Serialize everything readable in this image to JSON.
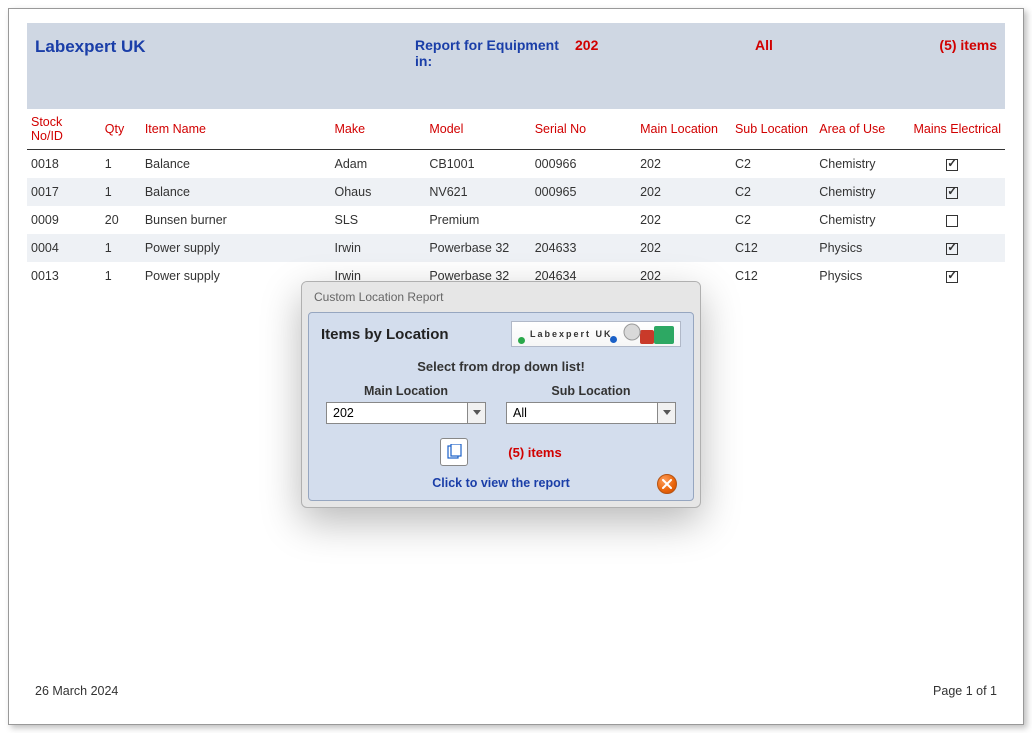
{
  "banner": {
    "title": "Labexpert UK",
    "report_label": "Report for Equipment in:",
    "location_value": "202",
    "filter_value": "All",
    "count_text": "(5) items"
  },
  "columns": {
    "stock": "Stock No/ID",
    "qty": "Qty",
    "item": "Item Name",
    "make": "Make",
    "model": "Model",
    "serial": "Serial No",
    "main_loc": "Main Location",
    "sub_loc": "Sub Location",
    "area": "Area of Use",
    "mains": "Mains Electrical"
  },
  "rows": [
    {
      "stock": "0018",
      "qty": "1",
      "item": "Balance",
      "make": "Adam",
      "model": "CB1001",
      "serial": "000966",
      "main": "202",
      "sub": "C2",
      "area": "Chemistry",
      "mains": true
    },
    {
      "stock": "0017",
      "qty": "1",
      "item": "Balance",
      "make": "Ohaus",
      "model": "NV621",
      "serial": "000965",
      "main": "202",
      "sub": "C2",
      "area": "Chemistry",
      "mains": true
    },
    {
      "stock": "0009",
      "qty": "20",
      "item": "Bunsen burner",
      "make": "SLS",
      "model": "Premium",
      "serial": "",
      "main": "202",
      "sub": "C2",
      "area": "Chemistry",
      "mains": false
    },
    {
      "stock": "0004",
      "qty": "1",
      "item": "Power supply",
      "make": "Irwin",
      "model": "Powerbase 32",
      "serial": "204633",
      "main": "202",
      "sub": "C12",
      "area": "Physics",
      "mains": true
    },
    {
      "stock": "0013",
      "qty": "1",
      "item": "Power supply",
      "make": "Irwin",
      "model": "Powerbase 32",
      "serial": "204634",
      "main": "202",
      "sub": "C12",
      "area": "Physics",
      "mains": true
    }
  ],
  "footer": {
    "date": "26 March 2024",
    "page": "Page 1 of 1"
  },
  "dialog": {
    "title": "Custom Location Report",
    "heading": "Items by Location",
    "logo_text": "Labexpert UK",
    "subtitle": "Select from drop down list!",
    "main_label": "Main Location",
    "main_value": "202",
    "sub_label": "Sub Location",
    "sub_value": "All",
    "count_text": "(5) items",
    "link_text": "Click to view the report"
  }
}
